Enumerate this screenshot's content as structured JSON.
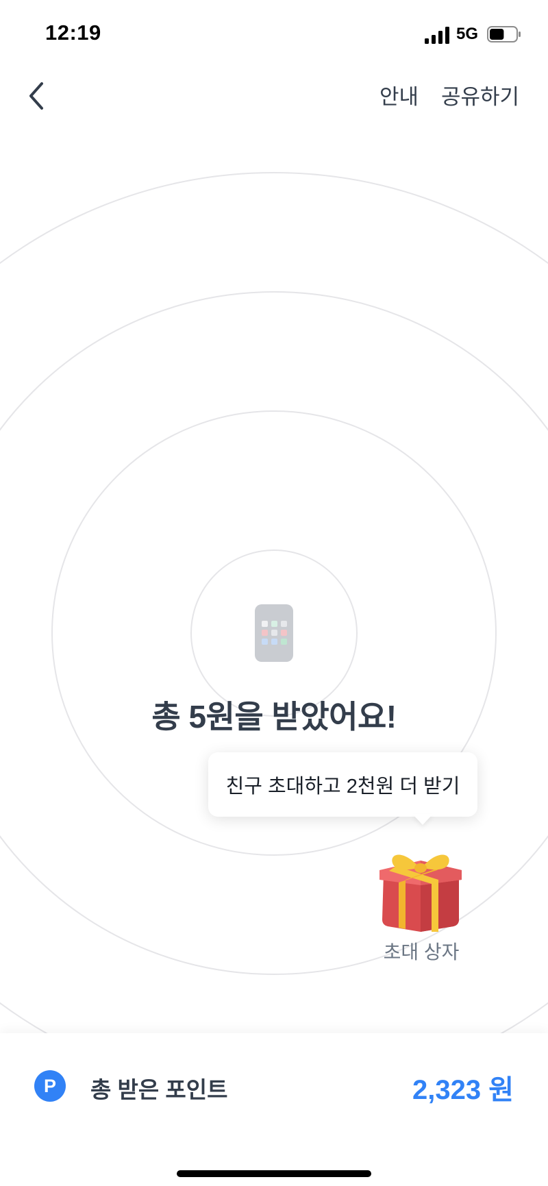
{
  "status_bar": {
    "time": "12:19",
    "network": "5G",
    "battery_level": 0.55
  },
  "nav": {
    "back_icon": "chevron-left-icon",
    "info_label": "안내",
    "share_label": "공유하기"
  },
  "main": {
    "headline": "총 5원을 받았어요!",
    "tooltip": "친구 초대하고 2천원 더 받기",
    "gift_label": "초대 상자"
  },
  "points": {
    "icon_letter": "P",
    "label": "총 받은 포인트",
    "value": "2,323 원"
  },
  "colors": {
    "accent": "#3182f6",
    "text_primary": "#333d4b",
    "text_secondary": "#6b7684",
    "ring": "#e5e5e8",
    "gift_box": "#e8585a",
    "gift_ribbon": "#f6c73b"
  }
}
